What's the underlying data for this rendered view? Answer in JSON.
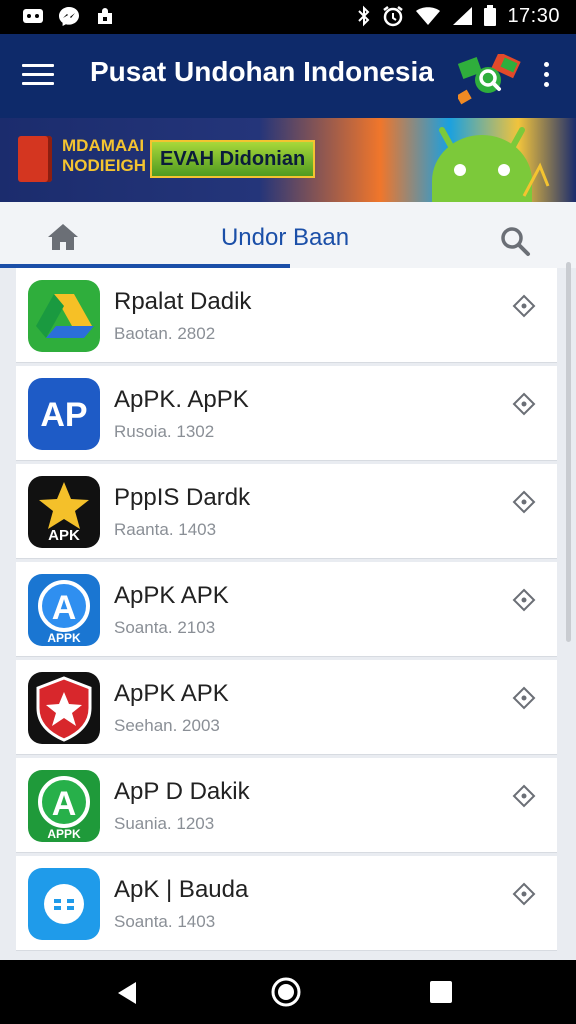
{
  "status_bar": {
    "time": "17:30",
    "left_icons": [
      "gamepad-icon",
      "messenger-icon",
      "notification-icon"
    ],
    "right_icons": [
      "bluetooth-icon",
      "alarm-icon",
      "wifi-icon",
      "signal-icon",
      "battery-icon"
    ]
  },
  "app_bar": {
    "title": "Pusat Undohan Indonesia",
    "menu_icon": "hamburger-menu-icon",
    "search_icon": "search-icon",
    "more_icon": "more-vert-icon",
    "color": "#0e2a6a"
  },
  "banner": {
    "text1_line1": "MDAMAAI",
    "text1_line2": "NODIEIGH",
    "text2": "EVAH Didonian"
  },
  "tabs": {
    "home_icon": "home-icon",
    "active_label": "Undor Baan",
    "search_icon": "search-icon",
    "accent": "#1b4fa8"
  },
  "apps": [
    {
      "name": "Rpalat Dadik",
      "sub": "Baotan. 2802",
      "icon": "google-drive-style-icon",
      "bg": "#2fae3c"
    },
    {
      "name": "ApPK. ApPK",
      "sub": "Rusoia. 1302",
      "icon": "ap-logo-icon",
      "bg": "#1e5bc6",
      "label": "AP"
    },
    {
      "name": "PppIS Dardk",
      "sub": "Raanta. 1403",
      "icon": "star-apk-icon",
      "bg": "#111111",
      "label": "APK"
    },
    {
      "name": "ApPK APK",
      "sub": "Soanta. 2103",
      "icon": "a-appk-blue-icon",
      "bg": "#1a76d2",
      "label": "APPK"
    },
    {
      "name": "ApPK APK",
      "sub": "Seehan. 2003",
      "icon": "shield-star-icon",
      "bg": "#111111"
    },
    {
      "name": "ApP D Dakik",
      "sub": "Suania. 1203",
      "icon": "a-appk-green-icon",
      "bg": "#1f9a3a",
      "label": "APPK"
    },
    {
      "name": "ApK | Bauda",
      "sub": "Soanta. 1403",
      "icon": "chat-bubble-icon",
      "bg": "#1f9bea"
    }
  ]
}
